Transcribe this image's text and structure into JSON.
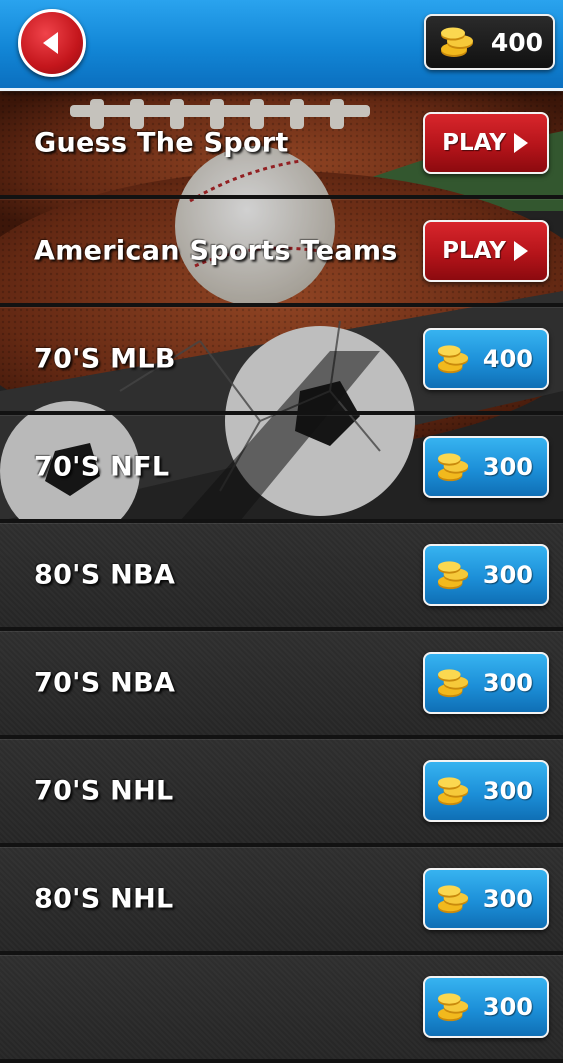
{
  "header": {
    "coin_balance": "400"
  },
  "icons": {
    "back": "left-arrow-icon",
    "coins": "coin-stack-icon",
    "play": "play-triangle-icon"
  },
  "colors": {
    "header_blue": "#1286d6",
    "play_red": "#b5141a",
    "price_blue": "#1c8fd8",
    "coin_gold": "#f2b91d"
  },
  "categories": [
    {
      "title": "Guess The Sport",
      "action": "play",
      "label": "PLAY"
    },
    {
      "title": "American Sports Teams",
      "action": "play",
      "label": "PLAY"
    },
    {
      "title": "70'S MLB",
      "action": "buy",
      "price": "400"
    },
    {
      "title": "70'S NFL",
      "action": "buy",
      "price": "300"
    },
    {
      "title": "80'S NBA",
      "action": "buy",
      "price": "300"
    },
    {
      "title": "70'S NBA",
      "action": "buy",
      "price": "300"
    },
    {
      "title": "70'S NHL",
      "action": "buy",
      "price": "300"
    },
    {
      "title": "80'S NHL",
      "action": "buy",
      "price": "300"
    },
    {
      "title": "",
      "action": "buy",
      "price": "300"
    }
  ]
}
